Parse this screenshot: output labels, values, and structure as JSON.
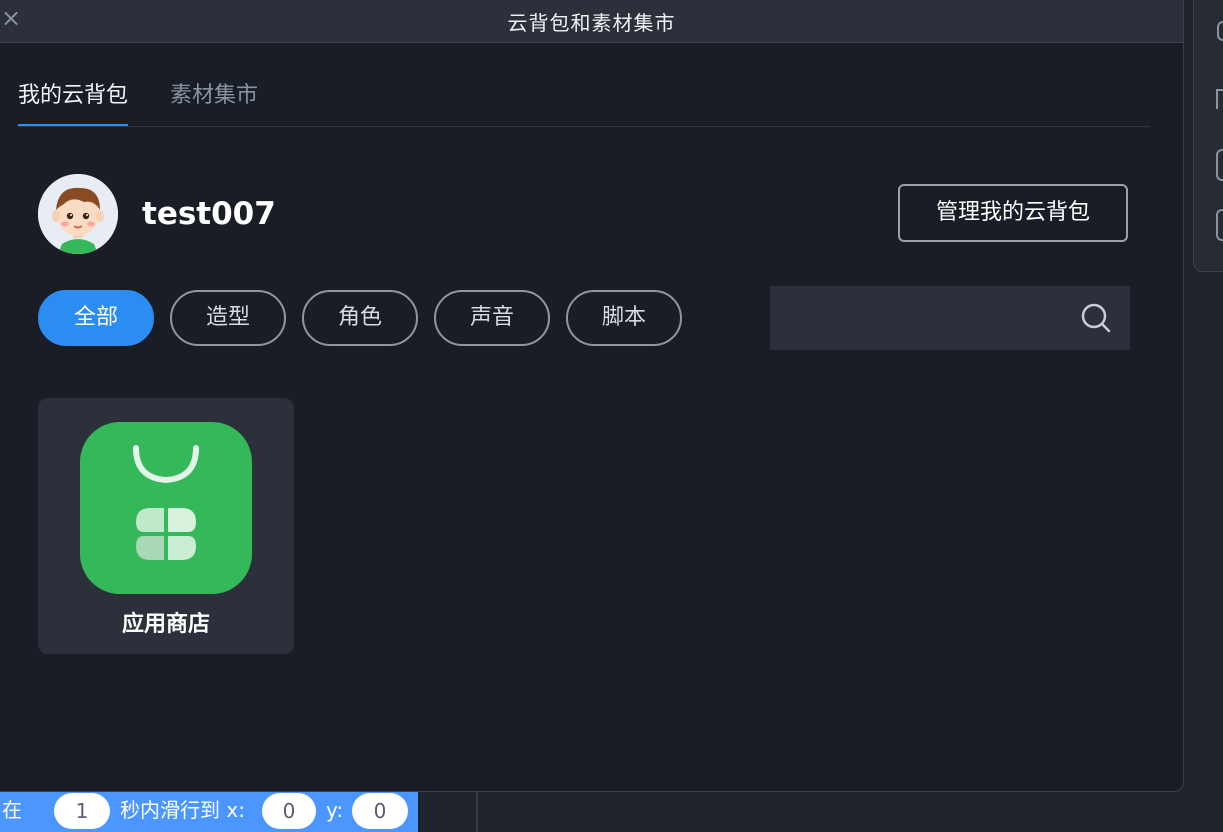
{
  "modal": {
    "title": "云背包和素材集市",
    "close_icon": "close-icon"
  },
  "tabs": [
    {
      "label": "我的云背包",
      "active": true
    },
    {
      "label": "素材集市",
      "active": false
    }
  ],
  "user": {
    "name": "test007",
    "avatar_icon": "boy-avatar"
  },
  "actions": {
    "manage_label": "管理我的云背包"
  },
  "filters": [
    {
      "label": "全部",
      "active": true
    },
    {
      "label": "造型",
      "active": false
    },
    {
      "label": "角色",
      "active": false
    },
    {
      "label": "声音",
      "active": false
    },
    {
      "label": "脚本",
      "active": false
    }
  ],
  "search": {
    "placeholder": "",
    "icon": "search-icon"
  },
  "items": [
    {
      "label": "应用商店",
      "icon": "app-store-bag-icon",
      "color": "#35b85a"
    }
  ],
  "block": {
    "prefix": "在",
    "seconds": "1",
    "middle": "秒内滑行到 x:",
    "x": "0",
    "y_label": "y:",
    "y": "0",
    "color": "#4c97ff"
  },
  "colors": {
    "accent": "#2b8cf2",
    "background": "#191d26",
    "header": "#2b303b"
  }
}
